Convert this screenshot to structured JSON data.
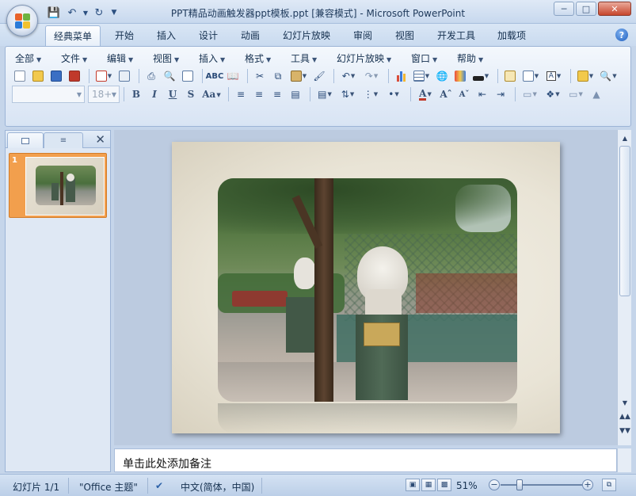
{
  "window": {
    "title": "PPT精品动画触发器ppt模板.ppt [兼容模式] - Microsoft PowerPoint"
  },
  "quick_access": {
    "icons": [
      "save-icon",
      "undo-icon",
      "redo-icon",
      "customize-icon"
    ]
  },
  "ribbon_tabs": [
    "经典菜单",
    "开始",
    "插入",
    "设计",
    "动画",
    "幻灯片放映",
    "审阅",
    "视图",
    "开发工具",
    "加载项"
  ],
  "active_tab": "经典菜单",
  "menu": [
    "全部",
    "文件",
    "编辑",
    "视图",
    "插入",
    "格式",
    "工具",
    "幻灯片放映",
    "窗口",
    "帮助"
  ],
  "format_bar": {
    "font_name": "",
    "font_size": "18+"
  },
  "slides_pane": {
    "tab_slides": "slides-tab-icon",
    "tab_outline": "outline-tab-icon",
    "slide_number": "1"
  },
  "notes": {
    "placeholder": "单击此处添加备注"
  },
  "status": {
    "slide_info": "幻灯片 1/1",
    "theme": "\"Office 主题\"",
    "language": "中文(简体，中国)",
    "zoom": "51%",
    "zoom_level": 0.51
  },
  "colors": {
    "accent_orange": "#f29f4d",
    "ribbon_blue": "#c9daef"
  }
}
